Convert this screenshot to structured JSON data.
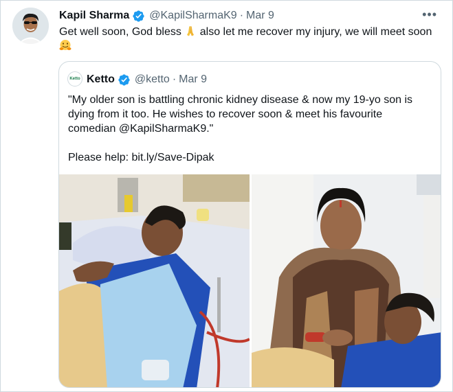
{
  "tweet": {
    "author_name": "Kapil Sharma",
    "author_handle": "@KapilSharmaK9",
    "separator": "·",
    "date": "Mar 9",
    "more_label": "•••",
    "text_part1": "Get well soon, God bless ",
    "text_part2": " also let me recover my injury, we will meet soon ",
    "emoji_1": "folded-hands-emoji",
    "emoji_2": "hugging-face-emoji"
  },
  "quoted_tweet": {
    "avatar_text": "Ketto",
    "author_name": "Ketto",
    "author_handle": "@ketto",
    "separator": "·",
    "date": "Mar 9",
    "text_line1": "\"My older son is battling chronic kidney disease & now my 19-yo son is dying from it too. He wishes to recover soon & meet his favourite comedian @KapilSharmaK9.\"",
    "text_line2": "Please help: bit.ly/Save-Dipak",
    "photos": [
      {
        "description_icon": "hospital-patient-photo"
      },
      {
        "description_icon": "mother-and-son-photo"
      }
    ]
  },
  "colors": {
    "verified_blue": "#1d9bf0",
    "text_primary": "#0f1419",
    "text_secondary": "#536471",
    "border": "#cfd9de"
  }
}
